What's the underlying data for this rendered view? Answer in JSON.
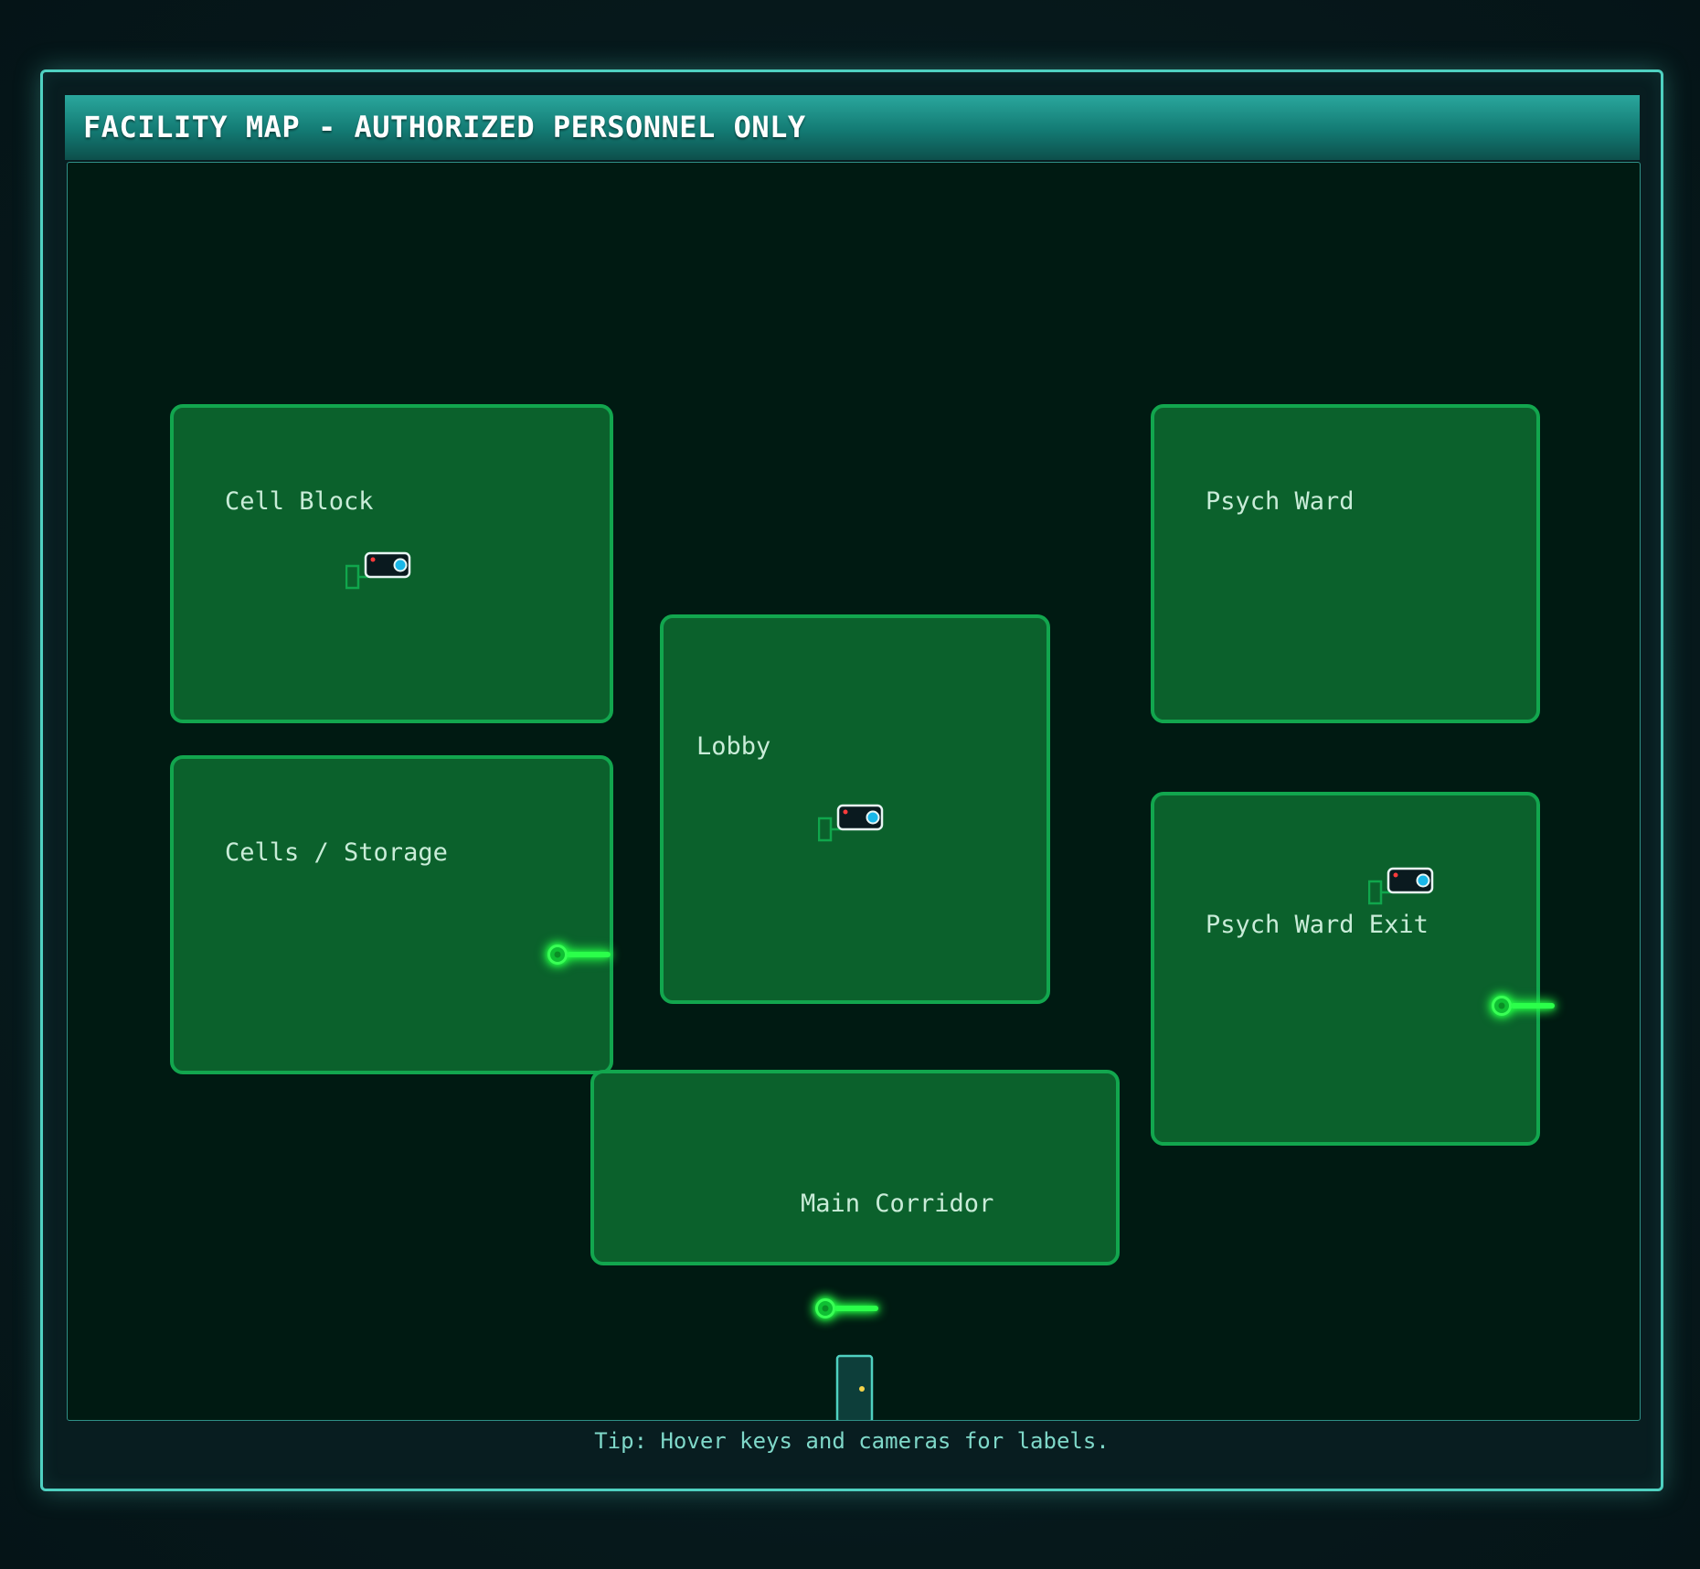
{
  "window": {
    "title": "FACILITY MAP - AUTHORIZED PERSONNEL ONLY"
  },
  "rooms": [
    {
      "id": "cell-block",
      "label": "Cell Block"
    },
    {
      "id": "cells-storage",
      "label": "Cells / Storage"
    },
    {
      "id": "lobby",
      "label": "Lobby"
    },
    {
      "id": "psych-ward",
      "label": "Psych Ward"
    },
    {
      "id": "psych-ward-exit",
      "label": "Psych Ward Exit"
    },
    {
      "id": "main-corridor",
      "label": "Main Corridor"
    }
  ],
  "icons": {
    "camera": "security-camera-icon",
    "key": "key-icon",
    "door": "door-icon"
  },
  "colors": {
    "room_fill": "#0b612c",
    "room_border": "#12a64e",
    "key_glow": "#22ff44",
    "frame_accent": "#4fd1c1",
    "title_bar": "#1f958c"
  },
  "footer": {
    "tip": "Tip: Hover keys and cameras for labels."
  }
}
